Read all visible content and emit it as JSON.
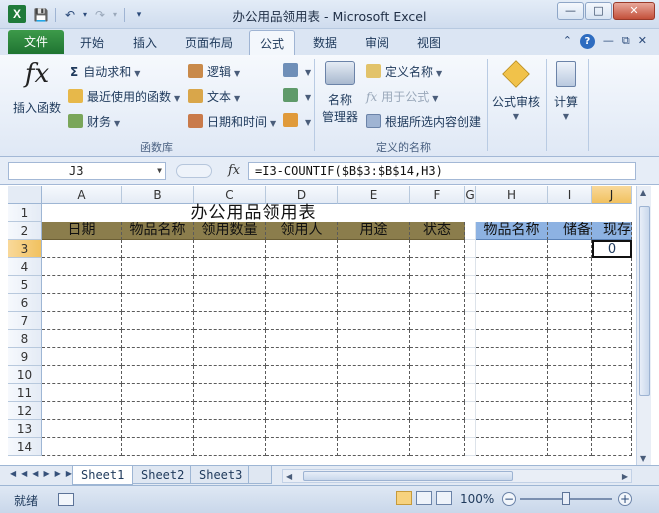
{
  "titlebar": {
    "title": "办公用品领用表 - Microsoft Excel",
    "logo_letter": "X",
    "qat_icons": [
      "save-icon",
      "undo-icon",
      "redo-icon",
      "customize-qat-icon"
    ]
  },
  "tabs": {
    "file": "文件",
    "items": [
      "开始",
      "插入",
      "页面布局",
      "公式",
      "数据",
      "审阅",
      "视图"
    ],
    "active": "公式"
  },
  "ribbon": {
    "insert_function": "插入函数",
    "insert_function_symbol": "fx",
    "autosum": "自动求和",
    "recent": "最近使用的函数",
    "financial": "财务",
    "logical": "逻辑",
    "text": "文本",
    "datetime": "日期和时间",
    "group_function_library": "函数库",
    "name_manager_line1": "名称",
    "name_manager_line2": "管理器",
    "define_name": "定义名称",
    "use_in_formula": "用于公式",
    "create_from_selection": "根据所选内容创建",
    "group_defined_names": "定义的名称",
    "formula_auditing": "公式审核",
    "calculation": "计算"
  },
  "formula_bar": {
    "name_box": "J3",
    "fx": "fx",
    "formula": "=I3-COUNTIF($B$3:$B$14,H3)"
  },
  "grid": {
    "columns": [
      "A",
      "B",
      "C",
      "D",
      "E",
      "F",
      "G",
      "H",
      "I",
      "J"
    ],
    "rows": [
      "1",
      "2",
      "3",
      "4",
      "5",
      "6",
      "7",
      "8",
      "9",
      "10",
      "11",
      "12",
      "13",
      "14"
    ],
    "title": "办公用品领用表",
    "left_headers": [
      "日期",
      "物品名称",
      "领用数量",
      "领用人",
      "用途",
      "状态"
    ],
    "right_headers": [
      "物品名称",
      "储备",
      "现存"
    ],
    "active_cell": "J3",
    "active_value": "0"
  },
  "sheets": {
    "tabs": [
      "Sheet1",
      "Sheet2",
      "Sheet3"
    ],
    "active": "Sheet1"
  },
  "status": {
    "ready": "就绪",
    "zoom": "100%",
    "minus": "−",
    "plus": "+"
  }
}
